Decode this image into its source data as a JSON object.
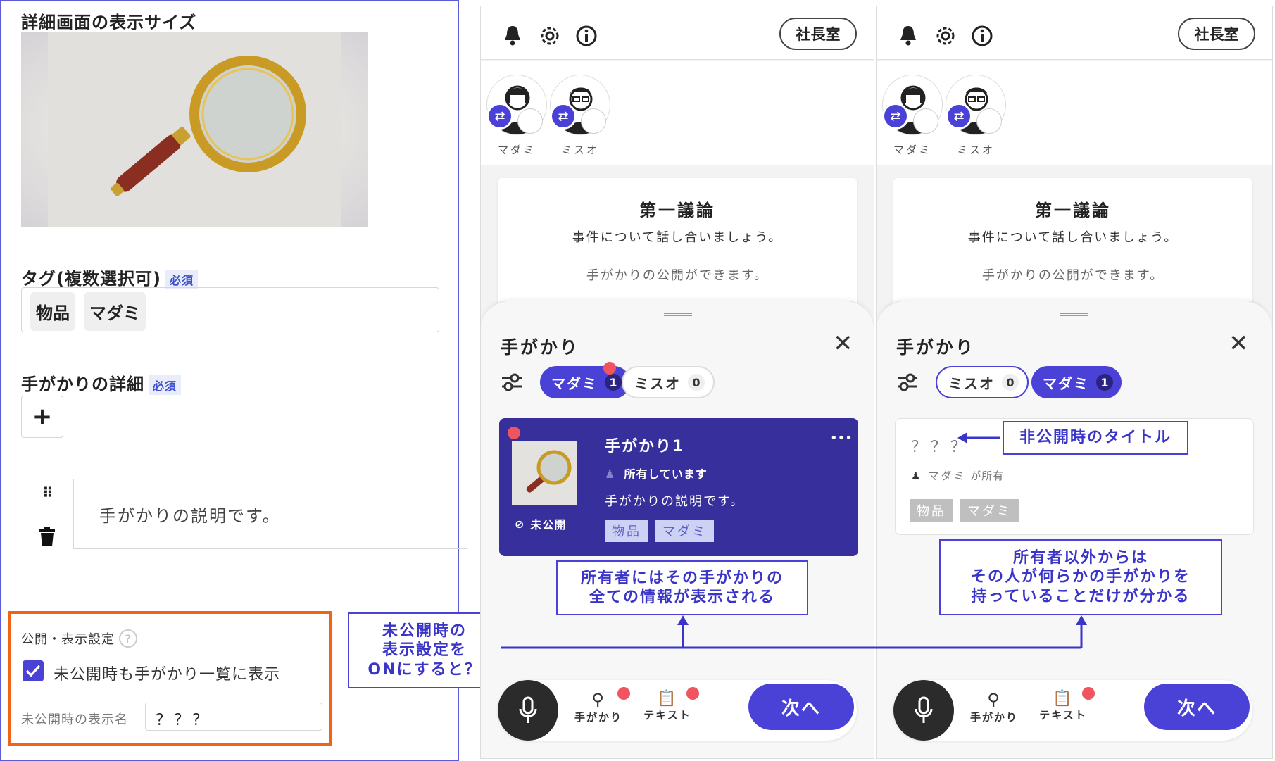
{
  "left": {
    "image_size_heading": "詳細画面の表示サイズ",
    "tags_heading": "タグ(複数選択可)",
    "required_badge": "必須",
    "tags": [
      "物品",
      "マダミ"
    ],
    "details_heading": "手がかりの詳細",
    "add_button": "+",
    "description_text": "手がかりの説明です。",
    "visibility_heading": "公開・表示設定",
    "help_icon": "?",
    "checkbox_label": "未公開時も手がかり一覧に表示",
    "checkbox_checked": true,
    "hidden_name_label": "未公開時の表示名",
    "hidden_name_value": "？？？"
  },
  "phone": {
    "room_button": "社長室",
    "players": [
      "マダミ",
      "ミスオ"
    ],
    "discussion_title": "第一議論",
    "discussion_sub": "事件について話し合いましょう。",
    "discussion_note": "手がかりの公開ができます。",
    "sheet_title": "手がかり",
    "nav_clues": "手がかり",
    "nav_text": "テキスト",
    "next_button": "次へ"
  },
  "phone1": {
    "tabs": [
      {
        "label": "マダミ",
        "count": "1"
      },
      {
        "label": "ミスオ",
        "count": "0"
      }
    ],
    "clue_title": "手がかり1",
    "owner_status": "所有しています",
    "clue_desc": "手がかりの説明です。",
    "hidden_label": "未公開",
    "more": "•••",
    "tags": [
      "物品",
      "マダミ"
    ]
  },
  "phone2": {
    "tabs": [
      {
        "label": "ミスオ",
        "count": "0"
      },
      {
        "label": "マダミ",
        "count": "1"
      }
    ],
    "clue_title": "？？？",
    "owner_name": "マダミ",
    "owner_suffix": "が所有",
    "tags": [
      "物品",
      "マダミ"
    ]
  },
  "callouts": {
    "toggle_question": [
      "未公開時の",
      "表示設定を",
      "ONにすると？"
    ],
    "owner_view": [
      "所有者にはその手がかりの",
      "全ての情報が表示される"
    ],
    "other_view": [
      "所有者以外からは",
      "その人が何らかの手がかりを",
      "持っていることだけが分かる"
    ],
    "hidden_title_label": "非公開時のタイトル"
  },
  "colors": {
    "accent": "#4a42d6",
    "highlight": "#f06418",
    "badge": "#f0545e"
  }
}
